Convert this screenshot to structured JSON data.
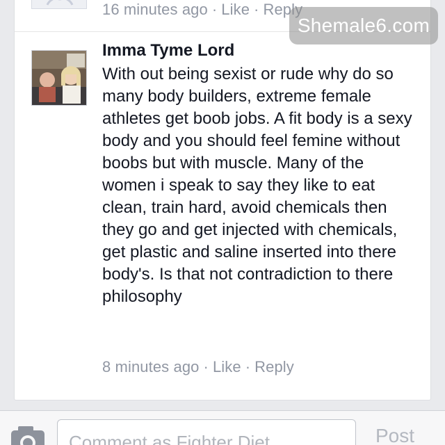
{
  "previous_comment": {
    "time": "16 minutes ago",
    "like_label": "Like",
    "reply_label": "Reply"
  },
  "comment": {
    "author": "Imma Tyme Lord",
    "text": "With out being sexist or rude why do so many body builders, extreme female athletes get boob jobs. A fit body is a sexy body and you should feel femine without boobs but with muscle. Many of the women i speak to say they like to eat clean, train hard, avoid chemicals then they go and get injected with chemicals, get plastic and saline inserted into there body's. Is that not contradiction to there philosophy",
    "time": "8 minutes ago",
    "like_label": "Like",
    "reply_label": "Reply"
  },
  "separator": "·",
  "watermark": "Shemale6.com",
  "composer": {
    "placeholder": "Comment as Fighter Diet",
    "post_label": "Post"
  },
  "colors": {
    "background": "#e9eaed",
    "card": "#ffffff",
    "text": "#141823",
    "meta": "#9197a3"
  },
  "icons": {
    "camera": "camera-icon"
  }
}
